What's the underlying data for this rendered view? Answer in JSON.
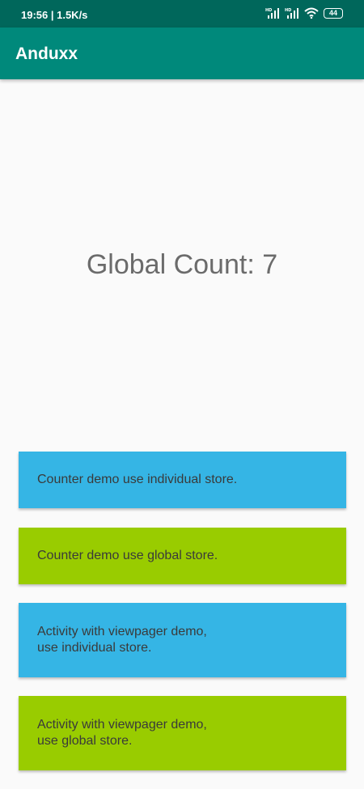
{
  "status_bar": {
    "time": "19:56 | 1.5K/s",
    "battery": "44",
    "icons": [
      "signal-hd-icon",
      "signal-hd-icon",
      "wifi-icon",
      "battery-icon"
    ]
  },
  "app_bar": {
    "title": "Anduxx",
    "color": "#00897b"
  },
  "main": {
    "global_count": "Global Count: 7"
  },
  "buttons": [
    {
      "label": "Counter demo use individual store.",
      "color": "#35b5e5"
    },
    {
      "label": "Counter demo use global store.",
      "color": "#99cc00"
    },
    {
      "label": "Activity with viewpager demo,\n use individual store.",
      "color": "#35b5e5"
    },
    {
      "label": "Activity with viewpager demo,\n use global store.",
      "color": "#99cc00"
    }
  ]
}
